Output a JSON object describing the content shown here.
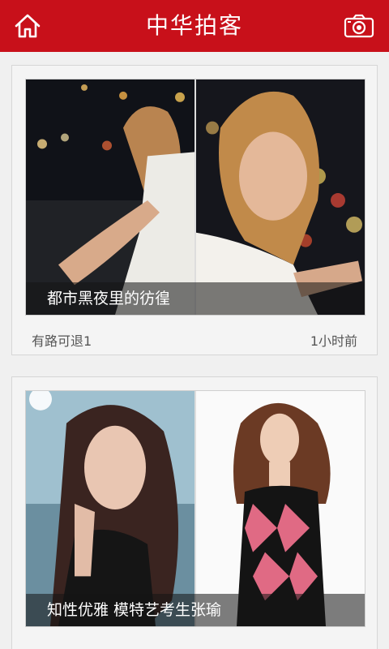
{
  "header": {
    "title": "中华拍客",
    "home_icon": "home-icon",
    "camera_icon": "camera-icon",
    "bg_color": "#c8101a"
  },
  "posts": [
    {
      "caption": "都市黑夜里的彷徨",
      "author": "有路可退1",
      "time": "1小时前"
    },
    {
      "caption": "知性优雅 模特艺考生张瑜",
      "author": "",
      "time": ""
    }
  ]
}
